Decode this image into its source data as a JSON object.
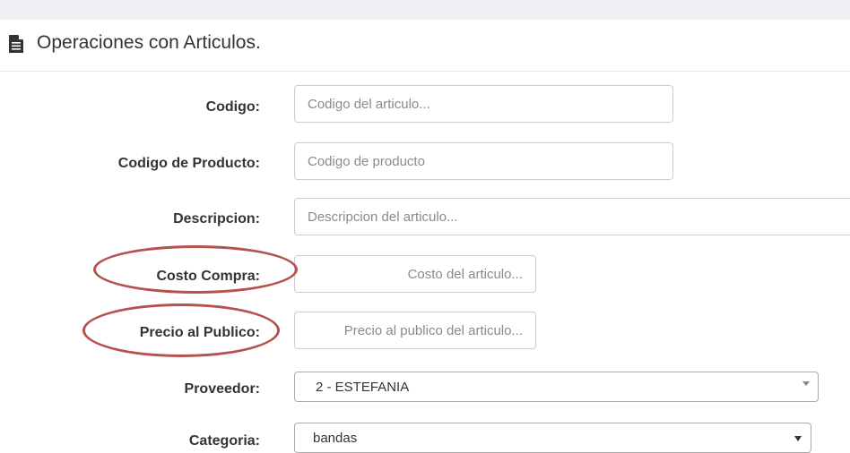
{
  "panel": {
    "icon": "document-icon",
    "title": "Operaciones con Articulos."
  },
  "form": {
    "codigo": {
      "label": "Codigo:",
      "placeholder": "Codigo del articulo..."
    },
    "codigo_producto": {
      "label": "Codigo de Producto:",
      "placeholder": "Codigo de producto"
    },
    "descripcion": {
      "label": "Descripcion:",
      "placeholder": "Descripcion del articulo..."
    },
    "costo_compra": {
      "label": "Costo Compra:",
      "placeholder": "Costo del articulo..."
    },
    "precio_publico": {
      "label": "Precio al Publico:",
      "placeholder": "Precio al publico del articulo..."
    },
    "proveedor": {
      "label": "Proveedor:",
      "value": "2 - ESTEFANIA"
    },
    "categoria": {
      "label": "Categoria:",
      "value": "bandas"
    }
  },
  "colors": {
    "annotation": "#b5514e",
    "label_text": "#333333",
    "placeholder_text": "#8a8a8a"
  }
}
